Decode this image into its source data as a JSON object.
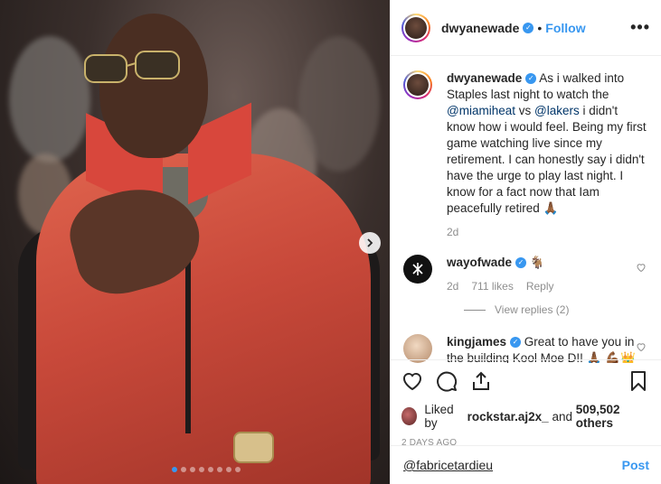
{
  "header": {
    "username": "dwyanewade",
    "separator": "•",
    "follow_label": "Follow",
    "more_label": "•••"
  },
  "caption": {
    "username": "dwyanewade",
    "text_1": "As i walked into Staples last night to watch the ",
    "mention_1": "@miamiheat",
    "text_2": " vs ",
    "mention_2": "@lakers",
    "text_3": " i didn't know how i would feel. Being my first game watching live since my retirement. I can honestly say i didn't have the urge to play last night. I know for a fact now that Iam peacefully retired 🙏🏾",
    "time": "2d"
  },
  "comments": [
    {
      "username": "wayofwade",
      "text": " 🐐",
      "time": "2d",
      "likes": "711 likes",
      "reply_label": "Reply",
      "view_replies": "View replies (2)"
    },
    {
      "username": "kingjames",
      "text": " Great to have you in the building Kool Moe D!! 🙏🏾 💪🏾👑"
    }
  ],
  "actions": {
    "liked_prefix": "Liked by ",
    "liked_user": "rockstar.aj2x_",
    "liked_and": " and ",
    "liked_count": "509,502 others",
    "time_ago": "2 DAYS AGO"
  },
  "add_comment": {
    "text": "@fabricetardieu",
    "post_label": "Post"
  },
  "carousel": {
    "total": 8,
    "active": 0
  },
  "colors": {
    "accent": "#3897f0",
    "text": "#262626",
    "muted": "#8e8e8e"
  }
}
